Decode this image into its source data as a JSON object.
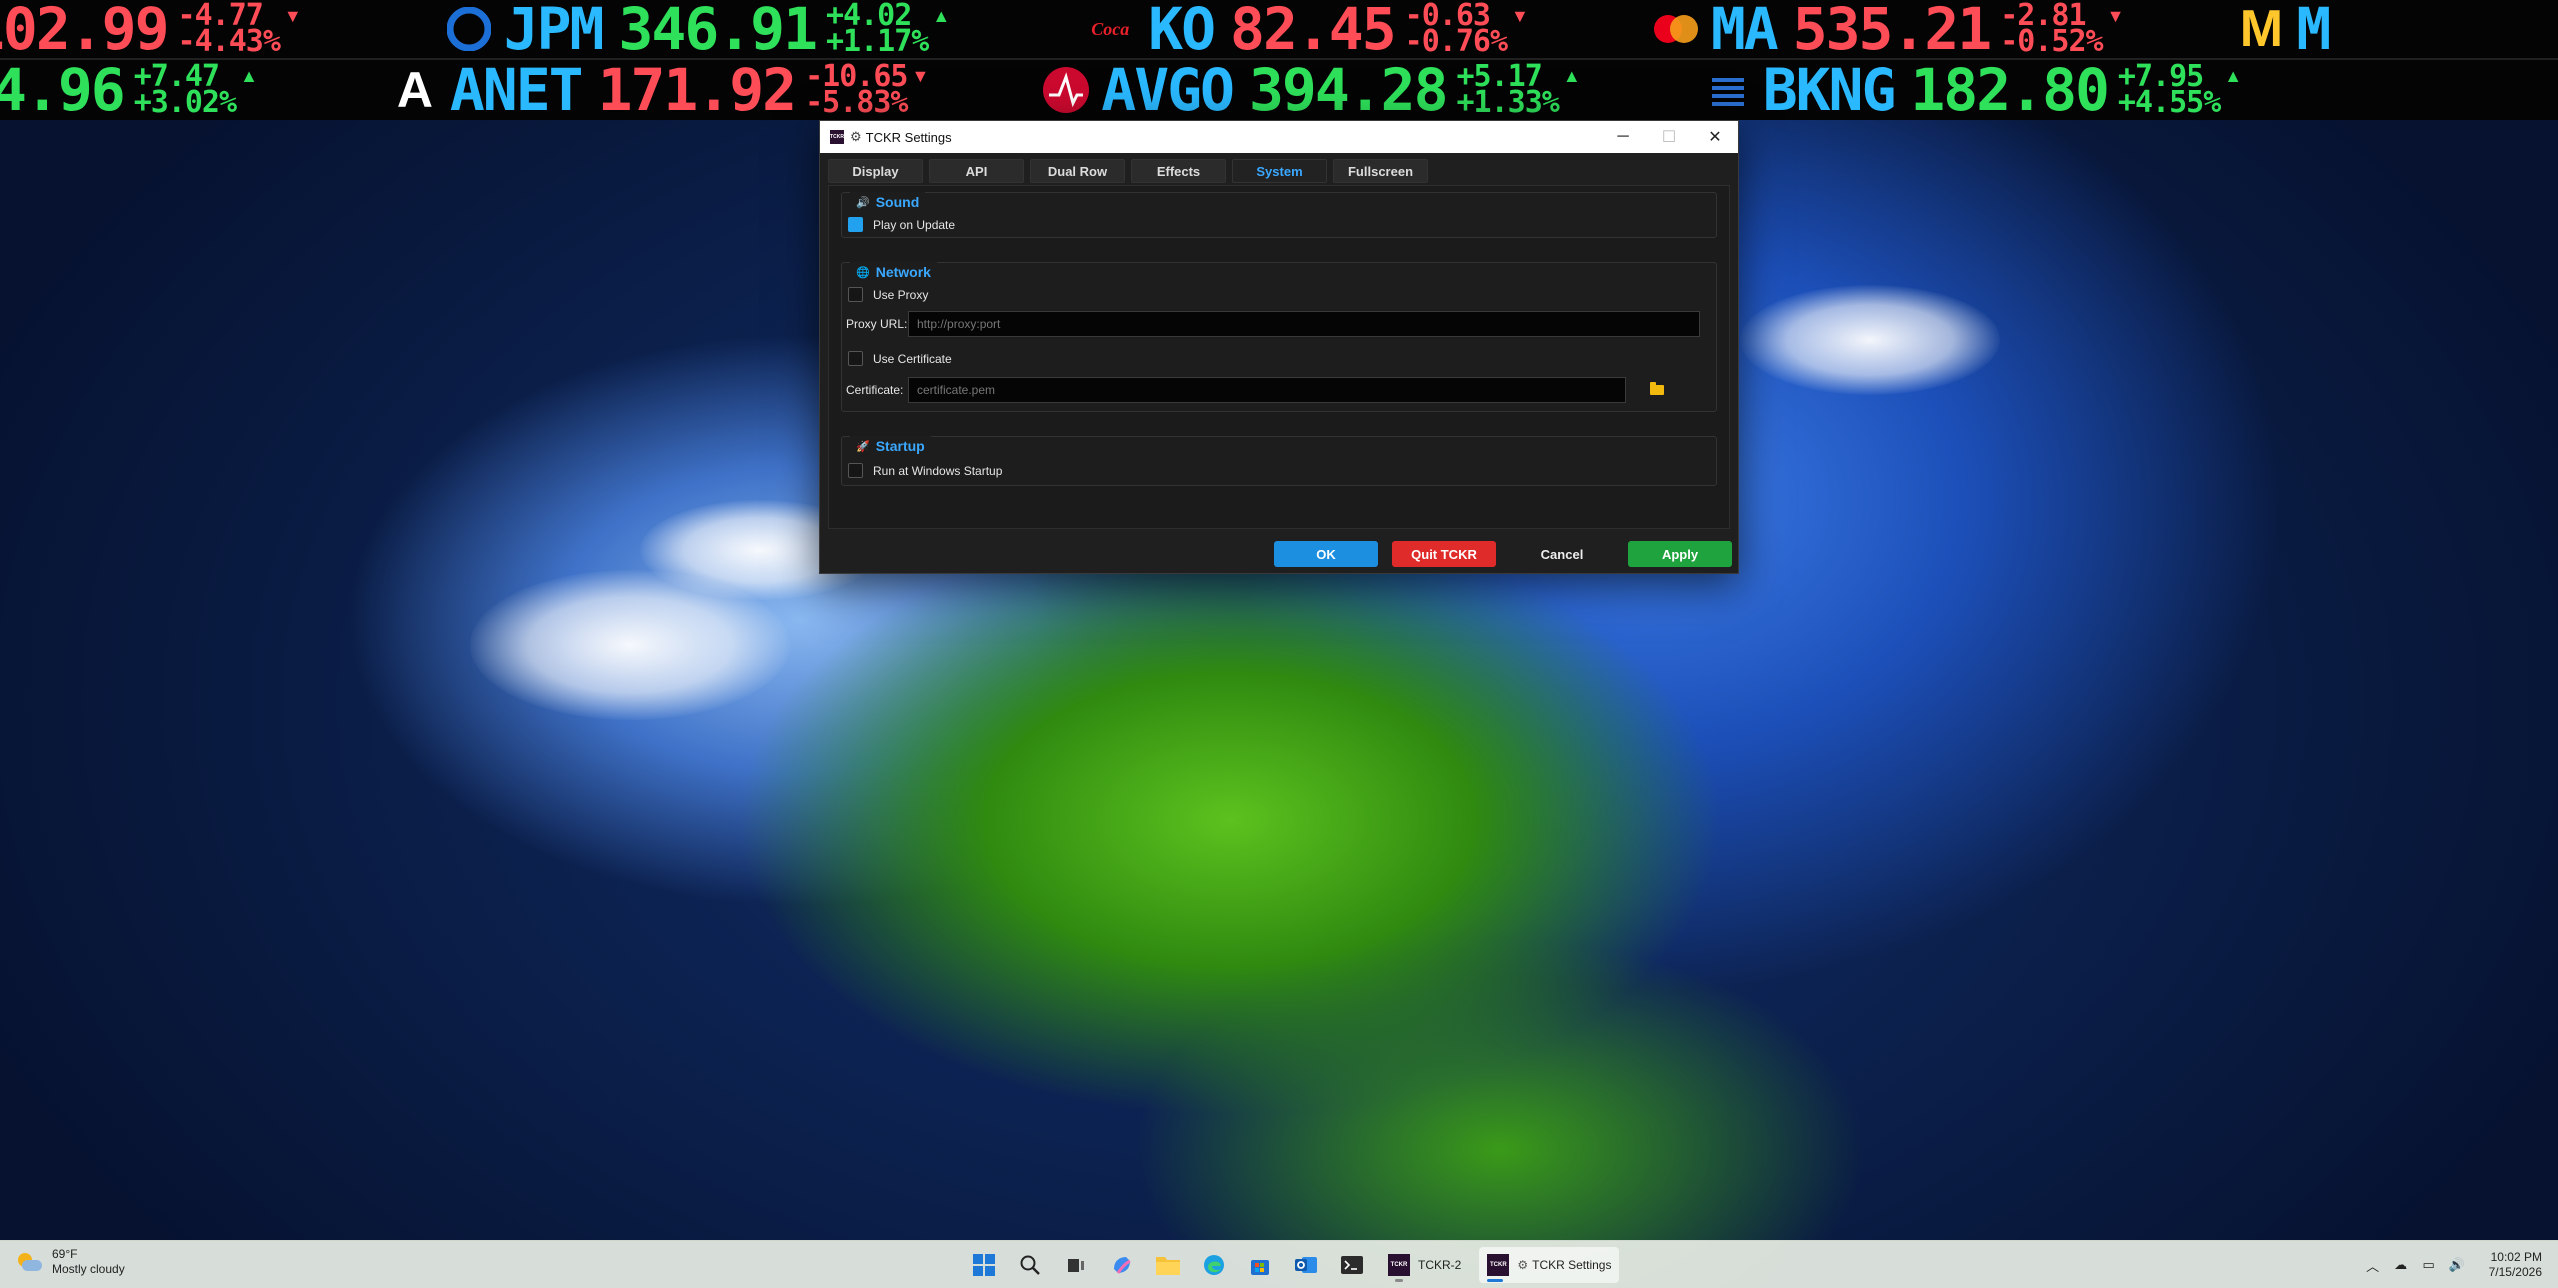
{
  "ticker_row1": [
    {
      "symbol": "",
      "price": "102.99",
      "change": "-4.77",
      "change_pct": "-4.43%",
      "dir": "down",
      "logo": ""
    },
    {
      "symbol": "JPM",
      "price": "346.91",
      "change": "+4.02",
      "change_pct": "+1.17%",
      "dir": "up",
      "logo": "jpm-logo"
    },
    {
      "symbol": "KO",
      "price": "82.45",
      "change": "-0.63",
      "change_pct": "-0.76%",
      "dir": "down",
      "logo": "coca-cola-logo"
    },
    {
      "symbol": "MA",
      "price": "535.21",
      "change": "-2.81",
      "change_pct": "-0.52%",
      "dir": "down",
      "logo": "mastercard-logo"
    },
    {
      "symbol": "M",
      "price": "",
      "change": "",
      "change_pct": "",
      "dir": "up",
      "logo": "mcdonalds-logo"
    }
  ],
  "ticker_row2": [
    {
      "symbol": "",
      "price": "4.96",
      "change": "+7.47",
      "change_pct": "+3.02%",
      "dir": "up",
      "logo": ""
    },
    {
      "symbol": "ANET",
      "price": "171.92",
      "change": "-10.65",
      "change_pct": "-5.83%",
      "dir": "down",
      "logo": "arista-logo"
    },
    {
      "symbol": "AVGO",
      "price": "394.28",
      "change": "+5.17",
      "change_pct": "+1.33%",
      "dir": "up",
      "logo": "broadcom-logo"
    },
    {
      "symbol": "BKNG",
      "price": "182.80",
      "change": "+7.95",
      "change_pct": "+4.55%",
      "dir": "up",
      "logo": "booking-logo"
    }
  ],
  "dialog": {
    "title": "TCKR Settings",
    "app_icon_text": "TCKR",
    "tabs": [
      {
        "label": "Display",
        "active": false
      },
      {
        "label": "API",
        "active": false
      },
      {
        "label": "Dual Row",
        "active": false
      },
      {
        "label": "Effects",
        "active": false
      },
      {
        "label": "System",
        "active": true
      },
      {
        "label": "Fullscreen",
        "active": false
      }
    ],
    "sound": {
      "title": "Sound",
      "play_on_update_label": "Play on Update",
      "play_on_update_checked": true
    },
    "network": {
      "title": "Network",
      "use_proxy_label": "Use Proxy",
      "use_proxy_checked": false,
      "proxy_url_label": "Proxy URL:",
      "proxy_url_placeholder": "http://proxy:port",
      "use_certificate_label": "Use Certificate",
      "use_certificate_checked": false,
      "certificate_label": "Certificate:",
      "certificate_placeholder": "certificate.pem"
    },
    "startup": {
      "title": "Startup",
      "run_at_startup_label": "Run at Windows Startup",
      "run_at_startup_checked": false
    },
    "buttons": {
      "ok": "OK",
      "quit": "Quit TCKR",
      "cancel": "Cancel",
      "apply": "Apply"
    }
  },
  "taskbar": {
    "weather_temp": "69°F",
    "weather_desc": "Mostly cloudy",
    "apps": [
      {
        "label": "TCKR-2"
      },
      {
        "label": "TCKR Settings"
      }
    ],
    "tckr_icon_text": "TCKR",
    "time": "10:02 PM",
    "date": "7/15/2026"
  },
  "colors": {
    "accent": "#3aa8ff",
    "ticker_up": "#2ee05a",
    "ticker_down": "#ff4d57",
    "ok_button": "#1d8fe0",
    "quit_button": "#e02b2b",
    "apply_button": "#1fa33e"
  }
}
